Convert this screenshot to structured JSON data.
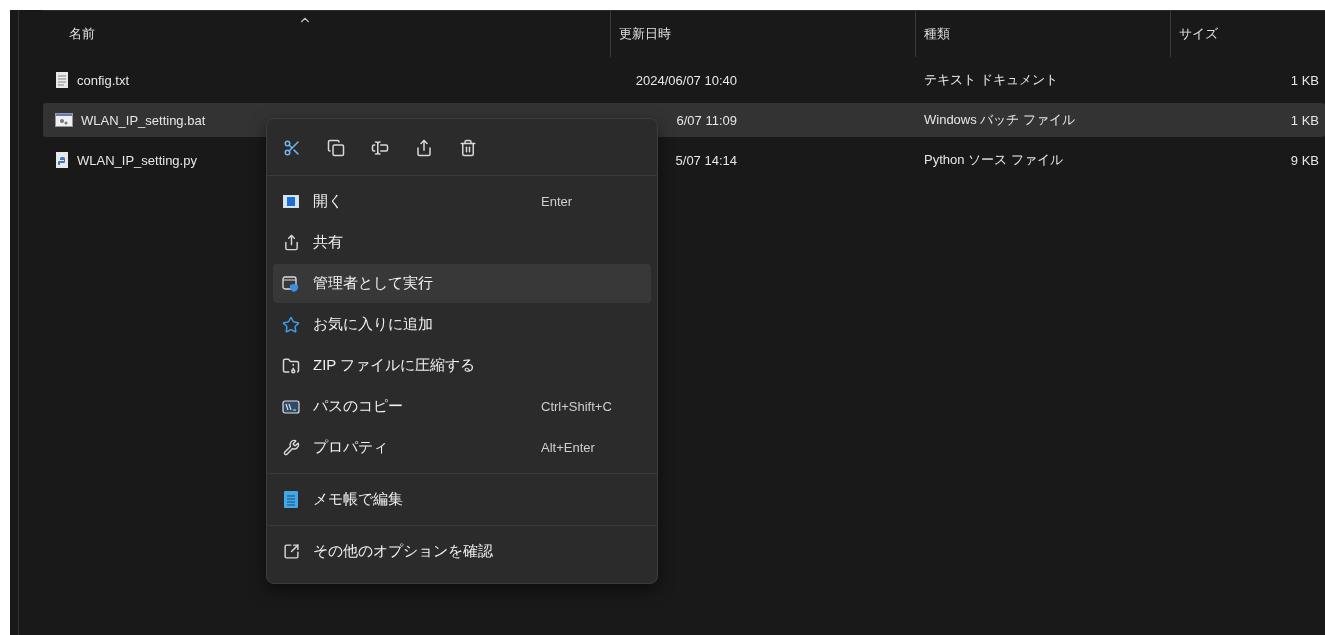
{
  "columns": [
    {
      "label": "名前",
      "sorted": true
    },
    {
      "label": "更新日時",
      "sorted": false
    },
    {
      "label": "種類",
      "sorted": false
    },
    {
      "label": "サイズ",
      "sorted": false
    }
  ],
  "rows": [
    {
      "name": "config.txt",
      "modified": "2024/06/07 10:40",
      "type": "テキスト ドキュメント",
      "size": "1 KB",
      "selected": false
    },
    {
      "name": "WLAN_IP_setting.bat",
      "modified": "6/07 11:09",
      "type": "Windows バッチ ファイル",
      "size": "1 KB",
      "selected": true
    },
    {
      "name": "WLAN_IP_setting.py",
      "modified": "5/07 14:14",
      "type": "Python ソース ファイル",
      "size": "9 KB",
      "selected": false
    }
  ],
  "context_menu": {
    "groups": [
      [
        {
          "label": "開く",
          "shortcut": "Enter",
          "selected": false
        },
        {
          "label": "共有",
          "selected": false
        },
        {
          "label": "管理者として実行",
          "selected": true
        },
        {
          "label": "お気に入りに追加",
          "selected": false
        },
        {
          "label": "ZIP ファイルに圧縮する",
          "selected": false
        },
        {
          "label": "パスのコピー",
          "shortcut": "Ctrl+Shift+C",
          "selected": false
        },
        {
          "label": "プロパティ",
          "shortcut": "Alt+Enter",
          "selected": false
        }
      ],
      [
        {
          "label": "メモ帳で編集",
          "selected": false
        }
      ],
      [
        {
          "label": "その他のオプションを確認",
          "selected": false
        }
      ]
    ]
  }
}
